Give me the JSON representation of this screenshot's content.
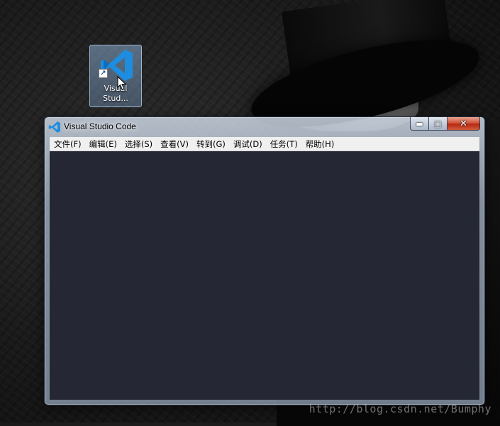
{
  "desktop": {
    "shortcut": {
      "label": "Visual\nStud...",
      "icon": "vscode-icon"
    },
    "watermark": "http://blog.csdn.net/Bumphy"
  },
  "window": {
    "title": "Visual Studio Code",
    "icon": "vscode-icon",
    "caption_buttons": {
      "minimize": "▬",
      "maximize": "□",
      "close": "✕"
    },
    "menu": [
      {
        "label": "文件(F)"
      },
      {
        "label": "编辑(E)"
      },
      {
        "label": "选择(S)"
      },
      {
        "label": "查看(V)"
      },
      {
        "label": "转到(G)"
      },
      {
        "label": "调试(D)"
      },
      {
        "label": "任务(T)"
      },
      {
        "label": "帮助(H)"
      }
    ]
  },
  "colors": {
    "editor_background": "#252734",
    "vscode_blue": "#1E8DE0",
    "close_button": "#c8452a",
    "menubar": "#f0f0f0"
  }
}
